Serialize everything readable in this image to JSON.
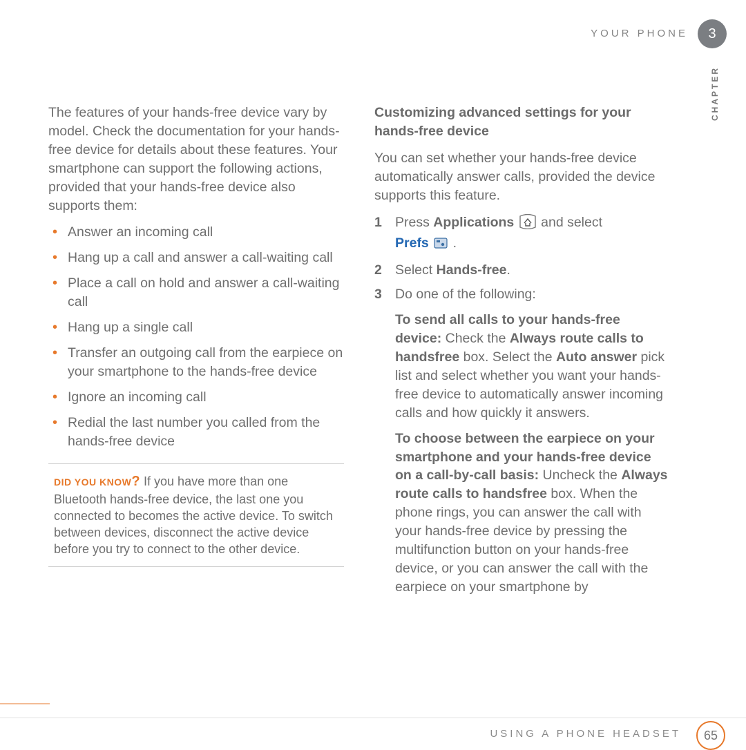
{
  "header": {
    "section": "YOUR PHONE",
    "chapter_num": "3",
    "chapter_word": "CHAPTER"
  },
  "left": {
    "intro": "The features of your hands-free device vary by model. Check the documentation for your hands-free device for details about these features. Your smartphone can support the following actions, provided that your hands-free device also supports them:",
    "bullets": [
      "Answer an incoming call",
      "Hang up a call and answer a call-waiting call",
      "Place a call on hold and answer a call-waiting call",
      "Hang up a single call",
      "Transfer an outgoing call from the earpiece on your smartphone to the hands-free device",
      "Ignore an incoming call",
      "Redial the last number you called from the hands-free device"
    ],
    "tip_prefix": "DID YOU KNOW",
    "tip_q": "?",
    "tip_body": "  If you have more than one Bluetooth hands-free device, the last one you connected to becomes the active device. To switch between devices, disconnect the active device before you try to connect to the other device."
  },
  "right": {
    "heading": "Customizing advanced settings for your hands-free device",
    "intro": "You can set whether your hands-free device automatically answer calls, provided the device supports this feature.",
    "step1_a": "Press ",
    "step1_b": "Applications",
    "step1_c": " and select ",
    "step1_d": "Prefs",
    "step1_e": " .",
    "step2_a": "Select ",
    "step2_b": "Hands-free",
    "step2_c": ".",
    "step3": "Do one of the following:",
    "blockA_lead": "To send all calls to your hands-free device: ",
    "blockA_1": "Check the ",
    "blockA_2": "Always route calls to handsfree",
    "blockA_3": " box. Select the ",
    "blockA_4": "Auto answer",
    "blockA_5": " pick list and select whether you want your hands-free device to automatically answer incoming calls and how quickly it answers.",
    "blockB_lead": "To choose between the earpiece on your smartphone and your hands-free device on a call-by-call basis: ",
    "blockB_1": "Uncheck the ",
    "blockB_2": "Always route calls to handsfree",
    "blockB_3": " box. When the phone rings, you can answer the call with your hands-free device by pressing the multifunction button on your hands-free device, or you can answer the call with the earpiece on your smartphone by"
  },
  "footer": {
    "section": "USING A PHONE HEADSET",
    "page": "65"
  }
}
